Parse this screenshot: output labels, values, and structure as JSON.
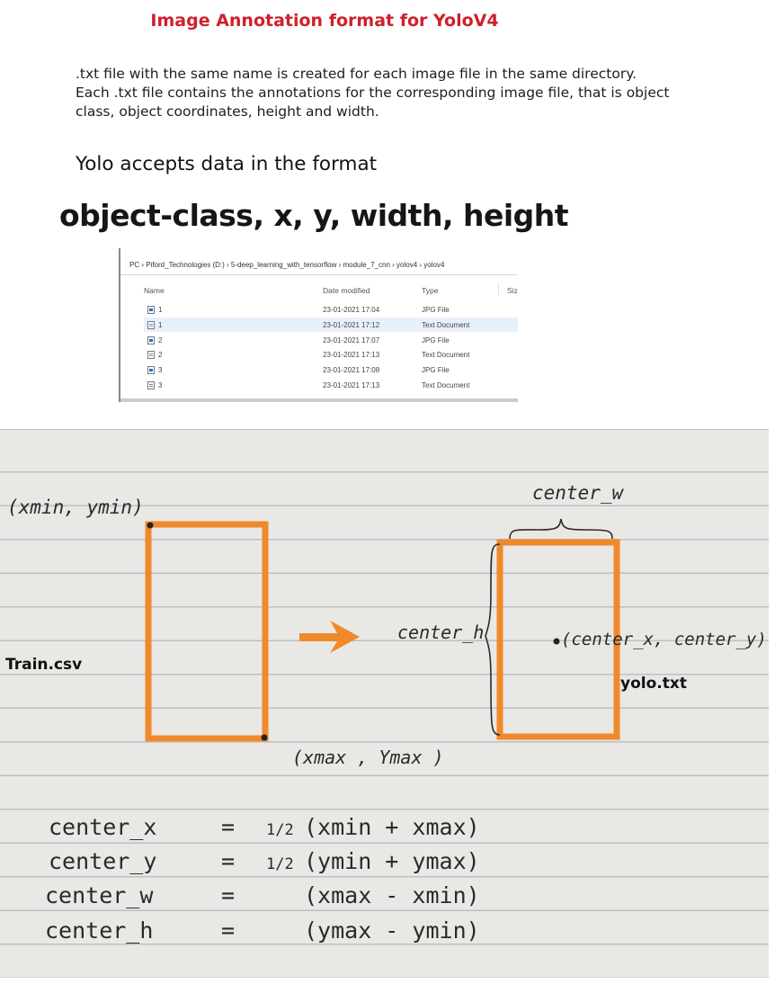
{
  "title": "Image Annotation format for YoloV4",
  "description": [
    ".txt file with the same name is created for each image file in the same directory.",
    "Each .txt file contains the annotations for the corresponding image file, that is object",
    "class, object coordinates, height and width."
  ],
  "accepts_text": "Yolo accepts data in the format",
  "format_text": "object-class,  x, y, width, height",
  "explorer": {
    "breadcrumb": "PC  ›  Piford_Technologies (D:)  ›  5-deep_learning_with_tensorflow  ›  module_7_cnn  ›  yolov4  ›  yolov4",
    "columns": [
      "Name",
      "Date modified",
      "Type",
      "Size"
    ],
    "rows": [
      {
        "name": "1",
        "date": "23-01-2021 17:04",
        "type": "JPG File",
        "icon": "image"
      },
      {
        "name": "1",
        "date": "23-01-2021 17:12",
        "type": "Text Document",
        "icon": "text"
      },
      {
        "name": "2",
        "date": "23-01-2021 17:07",
        "type": "JPG File",
        "icon": "image"
      },
      {
        "name": "2",
        "date": "23-01-2021 17:13",
        "type": "Text Document",
        "icon": "text"
      },
      {
        "name": "3",
        "date": "23-01-2021 17:08",
        "type": "JPG File",
        "icon": "image"
      },
      {
        "name": "3",
        "date": "23-01-2021 17:13",
        "type": "Text Document",
        "icon": "text"
      }
    ]
  },
  "diagram": {
    "label_min": "(xmin, ymin)",
    "label_max": "(xmax , Ymax )",
    "label_center_w": "center_w",
    "label_center_h": "center_h",
    "label_center_point": "(center_x, center_y)",
    "train_label": "Train.csv",
    "yolo_label": "yolo.txt",
    "box_color": "#f0892a"
  },
  "formulas": [
    {
      "lhs": "center_x",
      "eq": "=",
      "frac": "1/2",
      "rhs": "(xmin + xmax)"
    },
    {
      "lhs": "center_y",
      "eq": "=",
      "frac": "1/2",
      "rhs": "(ymin + ymax)"
    },
    {
      "lhs": "center_w",
      "eq": "=",
      "frac": "",
      "rhs": "(xmax - xmin)"
    },
    {
      "lhs": "center_h",
      "eq": "=",
      "frac": "",
      "rhs": "(ymax - ymin)"
    }
  ]
}
